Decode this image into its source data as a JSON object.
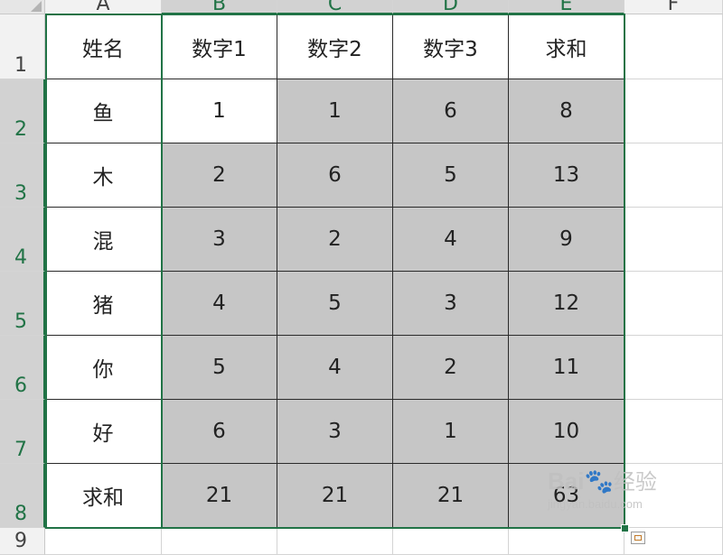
{
  "columns": [
    "A",
    "B",
    "C",
    "D",
    "E",
    "F"
  ],
  "rows": [
    "1",
    "2",
    "3",
    "4",
    "5",
    "6",
    "7",
    "8",
    "9"
  ],
  "cells": [
    [
      "姓名",
      "数字1",
      "数字2",
      "数字3",
      "求和"
    ],
    [
      "鱼",
      "1",
      "1",
      "6",
      "8"
    ],
    [
      "木",
      "2",
      "6",
      "5",
      "13"
    ],
    [
      "混",
      "3",
      "2",
      "4",
      "9"
    ],
    [
      "猪",
      "4",
      "5",
      "3",
      "12"
    ],
    [
      "你",
      "5",
      "4",
      "2",
      "11"
    ],
    [
      "好",
      "6",
      "3",
      "1",
      "10"
    ],
    [
      "求和",
      "21",
      "21",
      "21",
      "63"
    ]
  ],
  "colors": {
    "selection": "#217346",
    "shade": "#c6c6c6",
    "grid": "#d4d4d4"
  },
  "watermark": {
    "brand": "Bai",
    "brand_cn": "经验",
    "site": "jingyan.baidu.com"
  },
  "icons": {
    "corner": "select-all-triangle-icon",
    "quick_analysis": "quick-analysis-icon",
    "paw": "baidu-paw-icon"
  }
}
